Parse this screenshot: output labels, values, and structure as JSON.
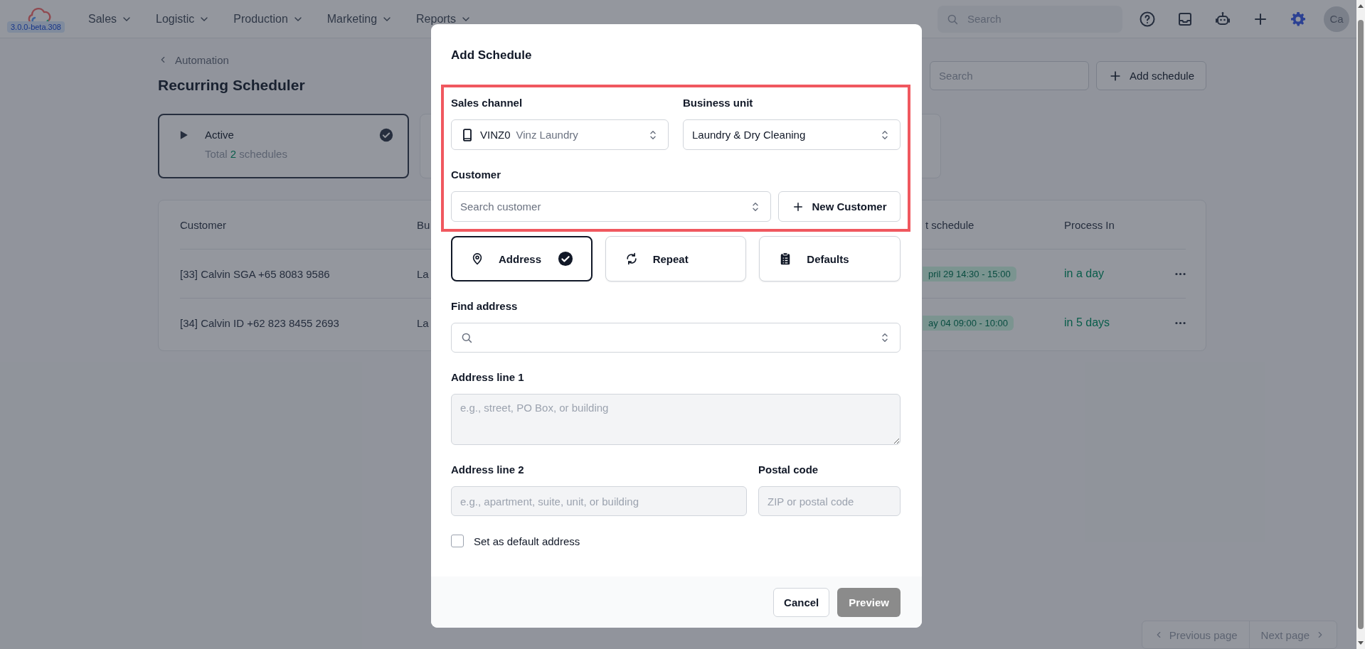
{
  "top_nav": {
    "version": "3.0.0-beta.308",
    "menu": [
      {
        "label": "Sales"
      },
      {
        "label": "Logistic"
      },
      {
        "label": "Production"
      },
      {
        "label": "Marketing"
      },
      {
        "label": "Reports"
      }
    ],
    "search": {
      "placeholder": "Search"
    },
    "avatar": "Ca"
  },
  "page": {
    "breadcrumb": "Automation",
    "title": "Recurring Scheduler",
    "search": {
      "placeholder": "Search"
    },
    "add_button": "Add schedule",
    "status_cards": [
      {
        "title": "Active",
        "summary": "Total **2** schedules",
        "selected": true
      },
      {
        "selected": false
      }
    ],
    "table": {
      "columns": [
        "Customer",
        "Bu",
        "t schedule",
        "Process In"
      ],
      "rows": [
        {
          "cells": [
            "[33] Calvin SGA +65 8083 9586",
            "La",
            "pril 29 14:30 - 15:00",
            "in a day"
          ]
        },
        {
          "cells": [
            "[34] Calvin ID +62 823 8455 2693",
            "La",
            "ay 04 09:00 - 10:00",
            "in 5 days"
          ]
        }
      ]
    },
    "pagination": {
      "previous": "Previous page",
      "next": "Next page"
    }
  },
  "modal": {
    "title": "Add Schedule",
    "sales_channel": {
      "label": "Sales channel",
      "code": "VINZ0",
      "name": "Vinz Laundry"
    },
    "business_unit": {
      "label": "Business unit",
      "value": "Laundry & Dry Cleaning"
    },
    "customer": {
      "label": "Customer",
      "placeholder": "Search customer",
      "new_button": "New Customer"
    },
    "tabs": [
      {
        "label": "Address",
        "selected": true
      },
      {
        "label": "Repeat",
        "selected": false
      },
      {
        "label": "Defaults",
        "selected": false
      }
    ],
    "find_address": {
      "label": "Find address",
      "disabled": false
    },
    "address_line_1": {
      "label": "Address line 1",
      "placeholder": "e.g., street, PO Box, or building",
      "disabled": true
    },
    "address_line_2": {
      "label": "Address line 2",
      "placeholder": "e.g., apartment, suite, unit, or building",
      "disabled": true
    },
    "postal_code": {
      "label": "Postal code",
      "placeholder": "ZIP or postal code",
      "disabled": true
    },
    "default_address": {
      "label": "Set as default address",
      "checked": false
    },
    "buttons": {
      "cancel": "Cancel",
      "preview": "Preview"
    }
  }
}
